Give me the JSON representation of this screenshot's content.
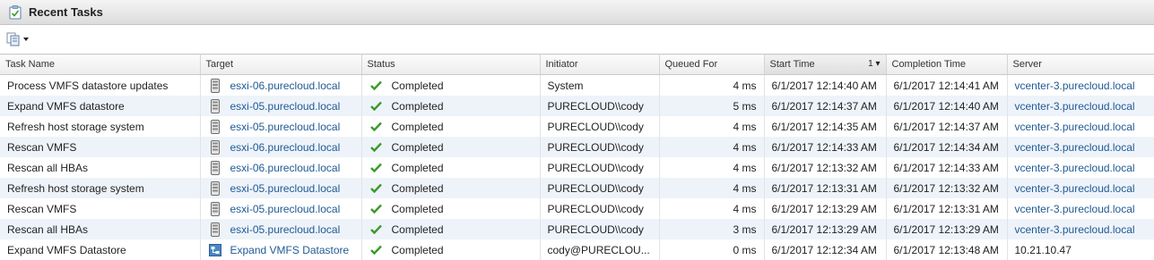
{
  "panel": {
    "title": "Recent Tasks"
  },
  "toolbar": {
    "export_icon": "export-list-icon"
  },
  "columns": [
    {
      "key": "task",
      "label": "Task Name"
    },
    {
      "key": "target",
      "label": "Target"
    },
    {
      "key": "status",
      "label": "Status"
    },
    {
      "key": "initiator",
      "label": "Initiator"
    },
    {
      "key": "queued",
      "label": "Queued For"
    },
    {
      "key": "start",
      "label": "Start Time",
      "sort_indicator": "1 ▾"
    },
    {
      "key": "completion",
      "label": "Completion Time"
    },
    {
      "key": "server",
      "label": "Server"
    }
  ],
  "rows": [
    {
      "task": "Process VMFS datastore updates",
      "target": "esxi-06.purecloud.local",
      "target_icon": "host-icon",
      "status": "Completed",
      "initiator": "System",
      "queued": "4 ms",
      "start": "6/1/2017 12:14:40 AM",
      "completion": "6/1/2017 12:14:41 AM",
      "server": "vcenter-3.purecloud.local"
    },
    {
      "task": "Expand VMFS datastore",
      "target": "esxi-05.purecloud.local",
      "target_icon": "host-icon",
      "status": "Completed",
      "initiator": "PURECLOUD\\\\cody",
      "queued": "5 ms",
      "start": "6/1/2017 12:14:37 AM",
      "completion": "6/1/2017 12:14:40 AM",
      "server": "vcenter-3.purecloud.local"
    },
    {
      "task": "Refresh host storage system",
      "target": "esxi-05.purecloud.local",
      "target_icon": "host-icon",
      "status": "Completed",
      "initiator": "PURECLOUD\\\\cody",
      "queued": "4 ms",
      "start": "6/1/2017 12:14:35 AM",
      "completion": "6/1/2017 12:14:37 AM",
      "server": "vcenter-3.purecloud.local"
    },
    {
      "task": "Rescan VMFS",
      "target": "esxi-06.purecloud.local",
      "target_icon": "host-icon",
      "status": "Completed",
      "initiator": "PURECLOUD\\\\cody",
      "queued": "4 ms",
      "start": "6/1/2017 12:14:33 AM",
      "completion": "6/1/2017 12:14:34 AM",
      "server": "vcenter-3.purecloud.local"
    },
    {
      "task": "Rescan all HBAs",
      "target": "esxi-06.purecloud.local",
      "target_icon": "host-icon",
      "status": "Completed",
      "initiator": "PURECLOUD\\\\cody",
      "queued": "4 ms",
      "start": "6/1/2017 12:13:32 AM",
      "completion": "6/1/2017 12:14:33 AM",
      "server": "vcenter-3.purecloud.local"
    },
    {
      "task": "Refresh host storage system",
      "target": "esxi-05.purecloud.local",
      "target_icon": "host-icon",
      "status": "Completed",
      "initiator": "PURECLOUD\\\\cody",
      "queued": "4 ms",
      "start": "6/1/2017 12:13:31 AM",
      "completion": "6/1/2017 12:13:32 AM",
      "server": "vcenter-3.purecloud.local"
    },
    {
      "task": "Rescan VMFS",
      "target": "esxi-05.purecloud.local",
      "target_icon": "host-icon",
      "status": "Completed",
      "initiator": "PURECLOUD\\\\cody",
      "queued": "4 ms",
      "start": "6/1/2017 12:13:29 AM",
      "completion": "6/1/2017 12:13:31 AM",
      "server": "vcenter-3.purecloud.local"
    },
    {
      "task": "Rescan all HBAs",
      "target": "esxi-05.purecloud.local",
      "target_icon": "host-icon",
      "status": "Completed",
      "initiator": "PURECLOUD\\\\cody",
      "queued": "3 ms",
      "start": "6/1/2017 12:13:29 AM",
      "completion": "6/1/2017 12:13:29 AM",
      "server": "vcenter-3.purecloud.local"
    },
    {
      "task": "Expand VMFS Datastore",
      "target": "Expand VMFS Datastore",
      "target_icon": "workflow-icon",
      "status": "Completed",
      "initiator": "cody@PURECLOU...",
      "queued": "0 ms",
      "start": "6/1/2017 12:12:34 AM",
      "completion": "6/1/2017 12:13:48 AM",
      "server": "10.21.10.47",
      "server_plain": true
    }
  ],
  "colors": {
    "link": "#1f5a94",
    "row_alt": "#eef3fa",
    "check": "#3a9a2a"
  }
}
